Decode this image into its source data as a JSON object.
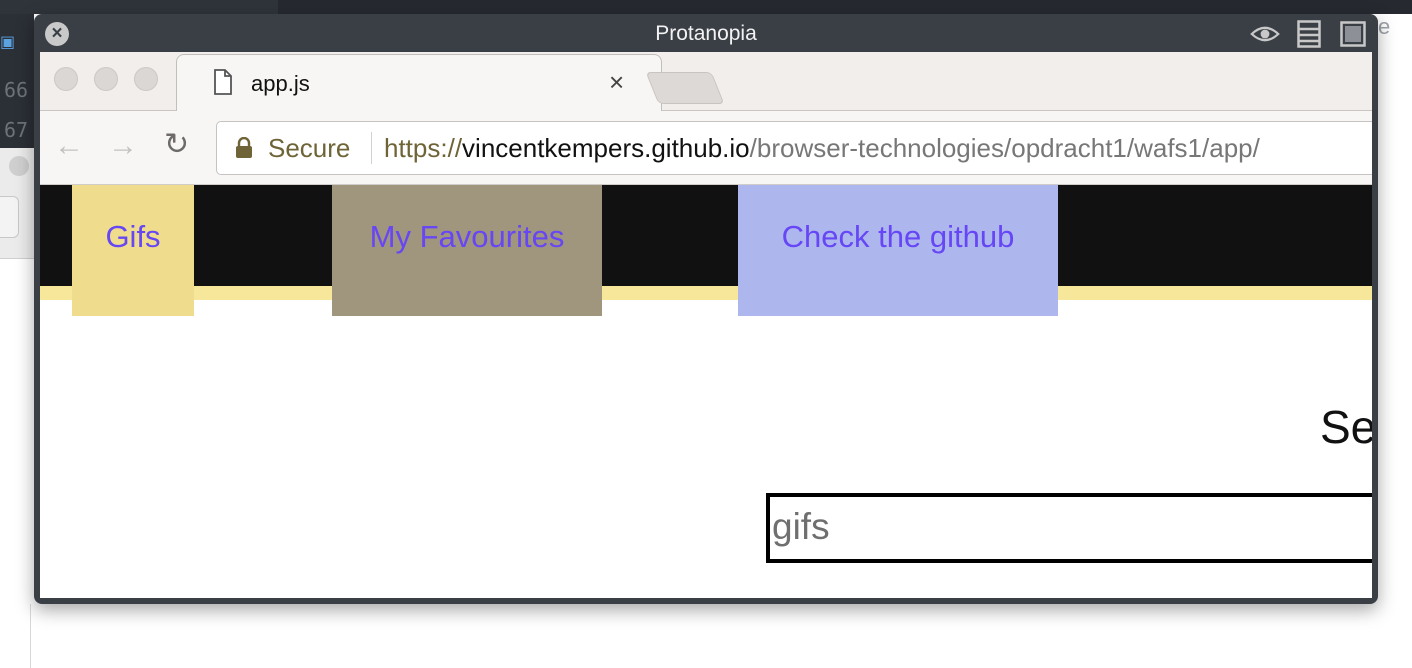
{
  "background_app": {
    "line_numbers": [
      "66",
      "67"
    ],
    "right_fragment": "e"
  },
  "sim_window": {
    "title": "Protanopia",
    "close_glyph": "×",
    "tools": [
      "eye-icon",
      "list-icon",
      "window-icon"
    ]
  },
  "browser": {
    "tab": {
      "title": "app.js",
      "close_glyph": "×"
    },
    "nav": {
      "back": "←",
      "forward": "→",
      "reload": "↻"
    },
    "omnibox": {
      "secure_label": "Secure",
      "url_scheme": "https://",
      "url_host": "vincentkempers.github.io",
      "url_path": "/browser-technologies/opdracht1/wafs1/app/"
    }
  },
  "page": {
    "nav_items": [
      {
        "label": "Gifs",
        "color": "#efdc8d"
      },
      {
        "label": "My Favourites",
        "color": "#a0957d"
      },
      {
        "label": "Check the github",
        "color": "#adb7ee"
      }
    ],
    "nav_text_color": "#6646f5",
    "heading": "Sear",
    "search": {
      "value": "gifs"
    }
  }
}
